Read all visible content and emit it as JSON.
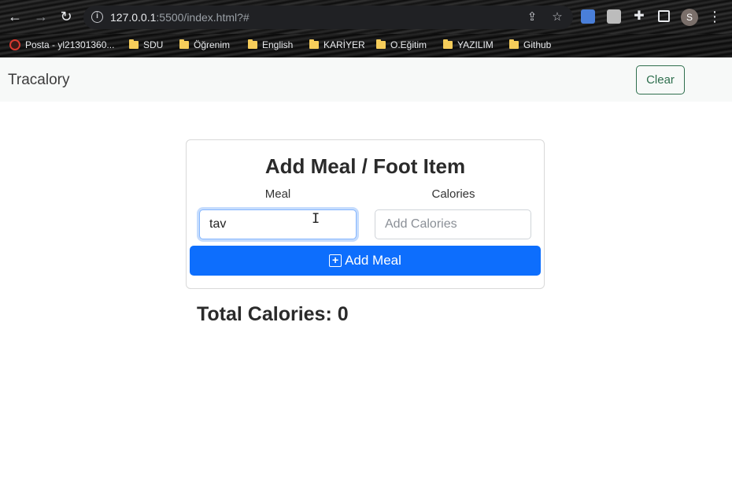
{
  "browser": {
    "url_host": "127.0.0.1",
    "url_rest": ":5500/index.html?#",
    "profile_initial": "S",
    "bookmarks": [
      {
        "label": "Posta - yl21301360...",
        "type": "site"
      },
      {
        "label": "SDU",
        "type": "folder"
      },
      {
        "label": "Öğrenim",
        "type": "folder"
      },
      {
        "label": "English",
        "type": "folder"
      },
      {
        "label": "KARİYER",
        "type": "folder"
      },
      {
        "label": "O.Eğitim",
        "type": "folder"
      },
      {
        "label": "YAZILIM",
        "type": "folder"
      },
      {
        "label": "Github",
        "type": "folder"
      }
    ]
  },
  "navbar": {
    "brand": "Tracalory",
    "clear_label": "Clear"
  },
  "form": {
    "title": "Add Meal / Foot Item",
    "meal_label": "Meal",
    "meal_value": "tav",
    "calories_label": "Calories",
    "calories_placeholder": "Add Calories",
    "add_label": "Add Meal"
  },
  "summary": {
    "total_label": "Total Calories:",
    "total_value": "0"
  },
  "colors": {
    "primary": "#0d6efd",
    "outline_success": "#2f6f4e"
  }
}
